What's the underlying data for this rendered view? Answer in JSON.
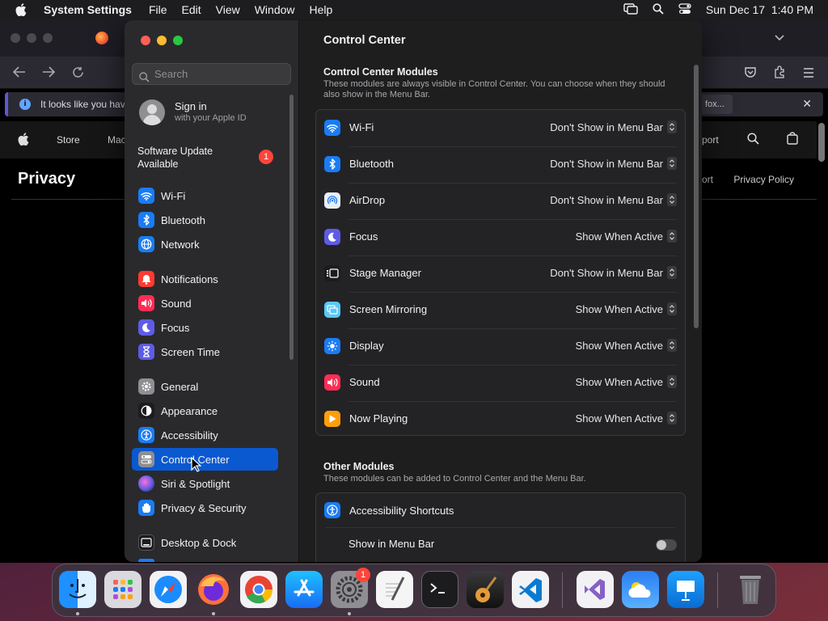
{
  "menubar": {
    "app_name": "System Settings",
    "menus": [
      "File",
      "Edit",
      "View",
      "Window",
      "Help"
    ],
    "clock": "Sun Dec 17  1:40 PM",
    "status_icons": [
      "screen-mirroring-icon",
      "search-icon",
      "control-center-icon"
    ]
  },
  "browser": {
    "notification_text": "It looks like you have",
    "notification_button": "fox...",
    "nav_links": [
      "Store",
      "Mac",
      "port"
    ],
    "page_heading": "Privacy",
    "page_links": [
      "ort",
      "Privacy Policy"
    ]
  },
  "sidebar": {
    "search_placeholder": "Search",
    "sign_in_title": "Sign in",
    "sign_in_subtitle": "with your Apple ID",
    "software_update": "Software Update Available",
    "software_update_badge": "1",
    "items": [
      {
        "label": "Wi-Fi",
        "icon": "wifi-icon",
        "color": "#1a7cf5"
      },
      {
        "label": "Bluetooth",
        "icon": "bluetooth-icon",
        "color": "#1a7cf5"
      },
      {
        "label": "Network",
        "icon": "globe-icon",
        "color": "#1a7cf5"
      },
      {
        "label": "Notifications",
        "icon": "bell-icon",
        "color": "#ff3b30"
      },
      {
        "label": "Sound",
        "icon": "speaker-icon",
        "color": "#ff2d55"
      },
      {
        "label": "Focus",
        "icon": "moon-icon",
        "color": "#5e5ce6"
      },
      {
        "label": "Screen Time",
        "icon": "hourglass-icon",
        "color": "#5e5ce6"
      },
      {
        "label": "General",
        "icon": "gear-icon",
        "color": "#8e8e93"
      },
      {
        "label": "Appearance",
        "icon": "appearance-icon",
        "color": "#1c1c1e"
      },
      {
        "label": "Accessibility",
        "icon": "accessibility-icon",
        "color": "#1a7cf5"
      },
      {
        "label": "Control Center",
        "icon": "toggles-icon",
        "color": "#8e8e93",
        "selected": true
      },
      {
        "label": "Siri & Spotlight",
        "icon": "siri-icon",
        "color": "#b14fd6"
      },
      {
        "label": "Privacy & Security",
        "icon": "hand-icon",
        "color": "#1a7cf5"
      },
      {
        "label": "Desktop & Dock",
        "icon": "dock-icon",
        "color": "#1c1c1e"
      }
    ]
  },
  "content": {
    "title": "Control Center",
    "modules_title": "Control Center Modules",
    "modules_desc": "These modules are always visible in Control Center. You can choose when they should also show in the Menu Bar.",
    "modules": [
      {
        "label": "Wi-Fi",
        "value": "Don't Show in Menu Bar",
        "icon": "wifi-icon",
        "color": "#1a7cf5"
      },
      {
        "label": "Bluetooth",
        "value": "Don't Show in Menu Bar",
        "icon": "bluetooth-icon",
        "color": "#1a7cf5"
      },
      {
        "label": "AirDrop",
        "value": "Don't Show in Menu Bar",
        "icon": "airdrop-icon",
        "color": "#e8eef5"
      },
      {
        "label": "Focus",
        "value": "Show When Active",
        "icon": "moon-icon",
        "color": "#5e5ce6"
      },
      {
        "label": "Stage Manager",
        "value": "Don't Show in Menu Bar",
        "icon": "stage-manager-icon",
        "color": "#1c1c1e"
      },
      {
        "label": "Screen Mirroring",
        "value": "Show When Active",
        "icon": "screen-mirroring-icon",
        "color": "#5ac8fa"
      },
      {
        "label": "Display",
        "value": "Show When Active",
        "icon": "sun-icon",
        "color": "#1a7cf5"
      },
      {
        "label": "Sound",
        "value": "Show When Active",
        "icon": "speaker-icon",
        "color": "#ff2d55"
      },
      {
        "label": "Now Playing",
        "value": "Show When Active",
        "icon": "play-icon",
        "color": "#ff9f0a"
      }
    ],
    "other_title": "Other Modules",
    "other_desc": "These modules can be added to Control Center and the Menu Bar.",
    "other_item": "Accessibility Shortcuts",
    "other_toggle_label": "Show in Menu Bar",
    "other_toggle_on": false
  },
  "dock": {
    "apps": [
      "finder-icon",
      "launchpad-icon",
      "safari-icon",
      "firefox-icon",
      "chrome-icon",
      "app-store-icon",
      "system-settings-icon",
      "textedit-icon",
      "terminal-icon",
      "garageband-icon",
      "vscode-icon",
      "visual-studio-icon",
      "weather-icon",
      "keynote-icon",
      "trash-icon"
    ],
    "settings_badge": "1"
  }
}
